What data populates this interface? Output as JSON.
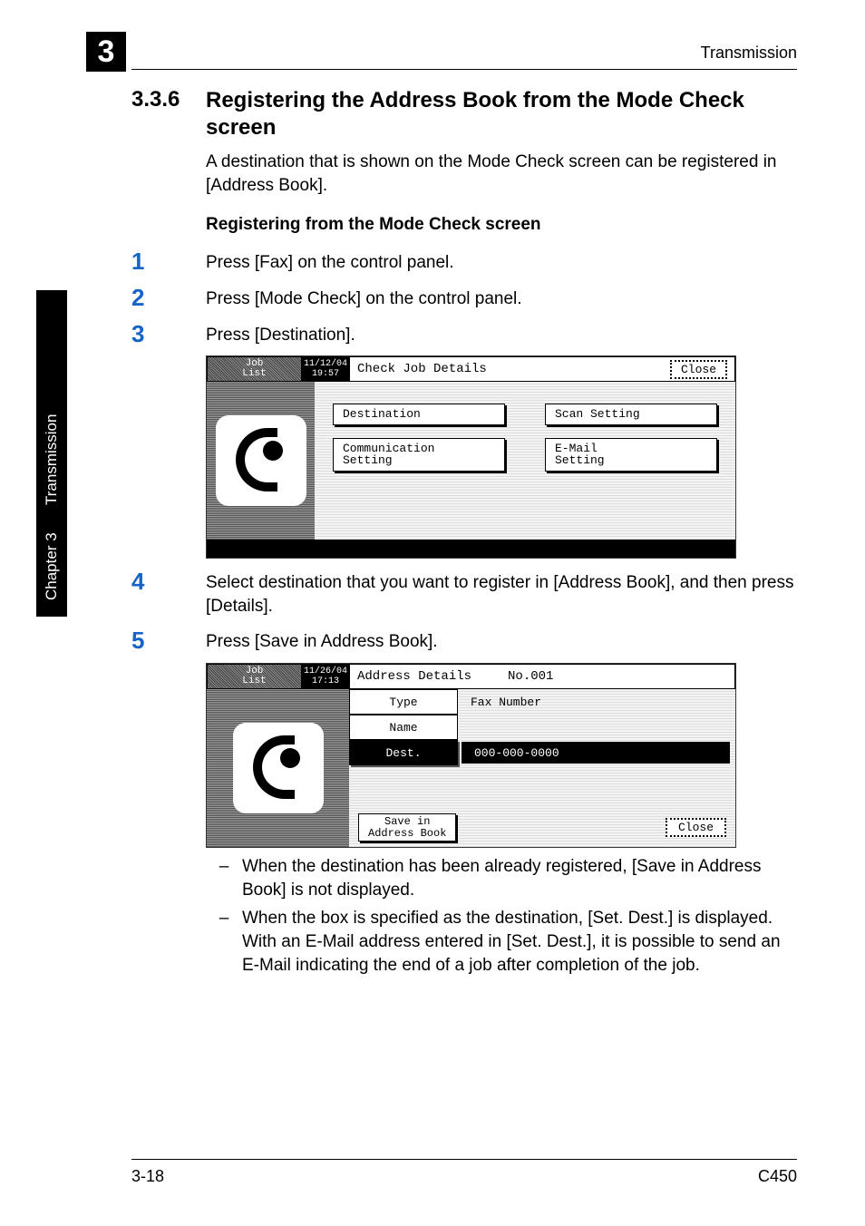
{
  "chapter_badge": "3",
  "running_head": "Transmission",
  "side_tab_line1": "Transmission",
  "side_tab_line2": "Chapter 3",
  "section": {
    "number": "3.3.6",
    "title": "Registering the Address Book from the Mode Check screen"
  },
  "intro_paragraph": "A destination that is shown on the Mode Check screen can be registered in [Address Book].",
  "sub_heading": "Registering from the Mode Check screen",
  "steps": {
    "s1": {
      "num": "1",
      "text": "Press [Fax] on the control panel."
    },
    "s2": {
      "num": "2",
      "text": "Press [Mode Check] on the control panel."
    },
    "s3": {
      "num": "3",
      "text": "Press [Destination]."
    },
    "s4": {
      "num": "4",
      "text": "Select destination that you want to register in [Address Book], and then press [Details]."
    },
    "s5": {
      "num": "5",
      "text": "Press [Save in Address Book]."
    }
  },
  "lcd1": {
    "job_tab": "Job\nList",
    "datetime": "11/12/04\n19:57",
    "title": "Check Job Details",
    "close": "Close",
    "btn_dest": "Destination",
    "btn_scan": "Scan Setting",
    "btn_comm": "Communication\nSetting",
    "btn_email": "E-Mail\nSetting"
  },
  "lcd2": {
    "job_tab": "Job\nList",
    "datetime": "11/26/04\n17:13",
    "title": "Address Details",
    "title_no": "No.001",
    "type_label": "Type",
    "type_value": "Fax Number",
    "name_label": "Name",
    "dest_label": "Dest.",
    "dest_value": "000-000-0000",
    "save_btn": "Save in\nAddress Book",
    "close": "Close"
  },
  "notes": {
    "n1": "When the destination has been already registered, [Save in Address Book] is not displayed.",
    "n2": "When the box is specified as the destination, [Set. Dest.] is displayed. With an E-Mail address entered in [Set. Dest.], it is possible to send an E-Mail indicating the end of a job after completion of the job."
  },
  "footer": {
    "left": "3-18",
    "right": "C450"
  }
}
